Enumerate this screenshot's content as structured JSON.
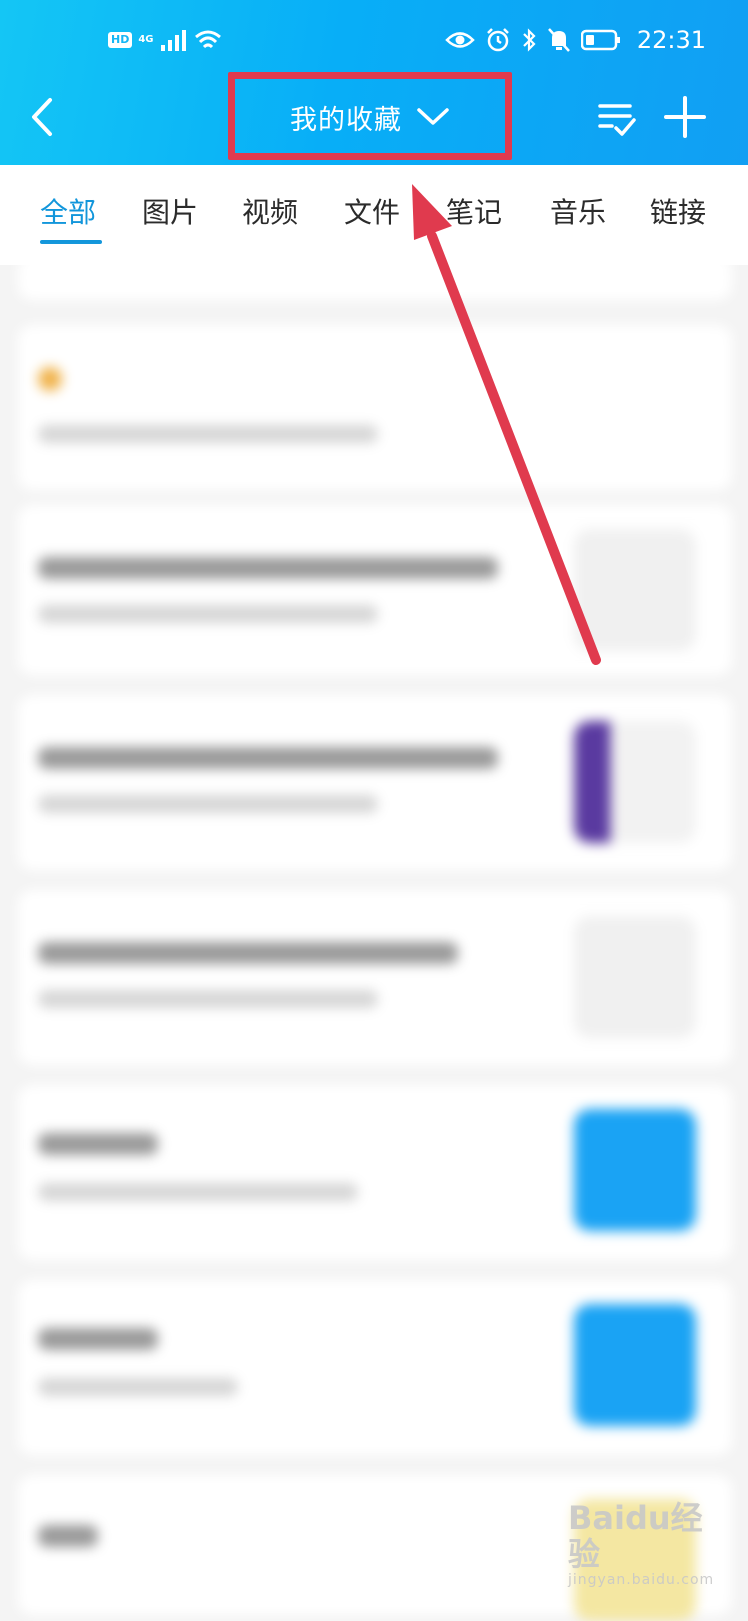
{
  "status_bar": {
    "hd": "HD",
    "network": "4G",
    "time": "22:31"
  },
  "header": {
    "title": "我的收藏"
  },
  "tabs": [
    {
      "label": "全部",
      "active": true
    },
    {
      "label": "图片",
      "active": false
    },
    {
      "label": "视频",
      "active": false
    },
    {
      "label": "文件",
      "active": false
    },
    {
      "label": "笔记",
      "active": false
    },
    {
      "label": "音乐",
      "active": false
    },
    {
      "label": "链接",
      "active": false
    }
  ],
  "watermark": {
    "text": "Baidu经验",
    "sub": "jingyan.baidu.com"
  },
  "colors": {
    "header_start": "#14c6f5",
    "header_end": "#119ff3",
    "accent": "#1296db",
    "annotation": "#e03a4e"
  }
}
